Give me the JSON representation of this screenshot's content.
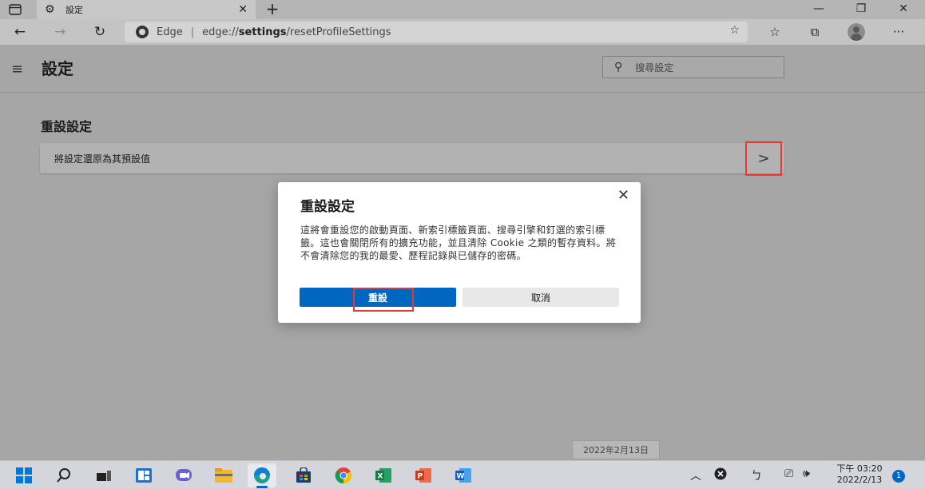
{
  "browser": {
    "tab": {
      "icon": "gear-icon",
      "title": "設定"
    },
    "window_controls": {
      "minimize": "—",
      "restore": "❐",
      "close": "✕"
    },
    "address": {
      "site_label": "Edge",
      "url_prefix": "edge://",
      "url_bold": "settings",
      "url_suffix": "/resetProfileSettings"
    }
  },
  "settings": {
    "page_title": "設定",
    "search_placeholder": "搜尋設定",
    "section_title": "重設設定",
    "reset_row_label": "將設定還原為其預設值",
    "reset_row_arrow": ">"
  },
  "dialog": {
    "title": "重設設定",
    "body": "這將會重設您的啟動頁面、新索引標籤頁面、搜尋引擎和釘選的索引標籤。這也會關閉所有的擴充功能，並且清除 Cookie 之類的暫存資料。將不會清除您的我的最愛、歷程記錄與已儲存的密碼。",
    "reset_button": "重設",
    "cancel_button": "取消"
  },
  "date_tooltip": "2022年2月13日",
  "taskbar": {
    "clock_time": "下午 03:20",
    "clock_date": "2022/2/13",
    "notification_count": "1"
  },
  "colors": {
    "accent": "#0067c0",
    "highlight_box": "#e53935"
  }
}
